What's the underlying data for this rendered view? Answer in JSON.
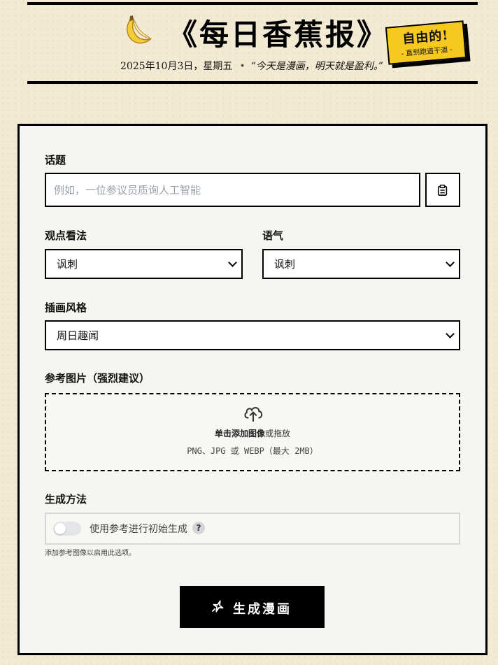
{
  "masthead": {
    "title": "《每日香蕉报》",
    "date": "2025年10月3日，星期五",
    "quote": "“今天是漫画，明天就是盈利。”",
    "stamp_big": "自由的!",
    "stamp_small": "- 直到跑道干涸 -",
    "banana_icon": "banana-icon",
    "stamp_color": "#f5c91f"
  },
  "form": {
    "topic_label": "话题",
    "topic_placeholder": "例如，一位参议员质询人工智能",
    "topic_button_icon": "clipboard-icon",
    "viewpoint_label": "观点看法",
    "viewpoint_value": "讽刺",
    "tone_label": "语气",
    "tone_value": "讽刺",
    "style_label": "插画风格",
    "style_value": "周日趣闻",
    "reference_label": "参考图片（强烈建议）",
    "upload_icon": "cloud-upload-icon",
    "upload_link": "单击添加图像",
    "upload_or": "或拖放",
    "upload_formats": "PNG、JPG 或 WEBP（最大 2MB）",
    "method_label": "生成方法",
    "toggle_label": "使用参考进行初始生成",
    "toggle_on": false,
    "help_mark": "?",
    "method_hint": "添加参考图像以启用此选项。",
    "generate_label": "生成漫画",
    "generate_icon": "sparkle-icon"
  }
}
